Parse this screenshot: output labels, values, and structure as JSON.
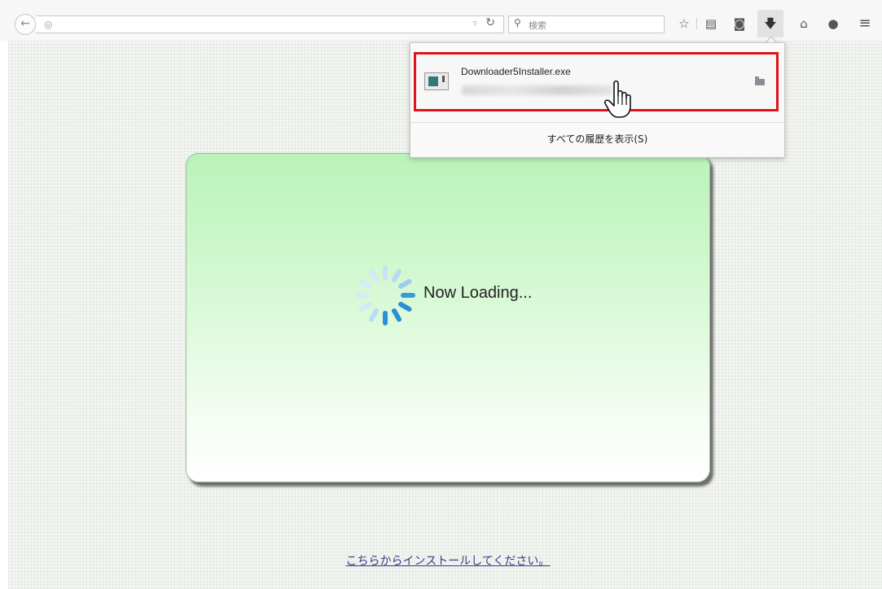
{
  "toolbar": {
    "search_placeholder": "検索",
    "icons": [
      "back-icon",
      "globe-icon",
      "reload-icon",
      "search-icon",
      "star-icon",
      "clipboard-icon",
      "pocket-icon",
      "download-icon",
      "home-icon",
      "chat-icon",
      "menu-icon"
    ]
  },
  "page": {
    "loading_text": "Now Loading...",
    "install_link": "こちらからインストールしてください。"
  },
  "downloads": {
    "file_name": "Downloader5Installer.exe",
    "show_all": "すべての履歴を表示(S)"
  },
  "colors": {
    "highlight_border": "#e0121a",
    "spinner_blue": "#2a8fd6",
    "link": "#3c3c8c"
  }
}
